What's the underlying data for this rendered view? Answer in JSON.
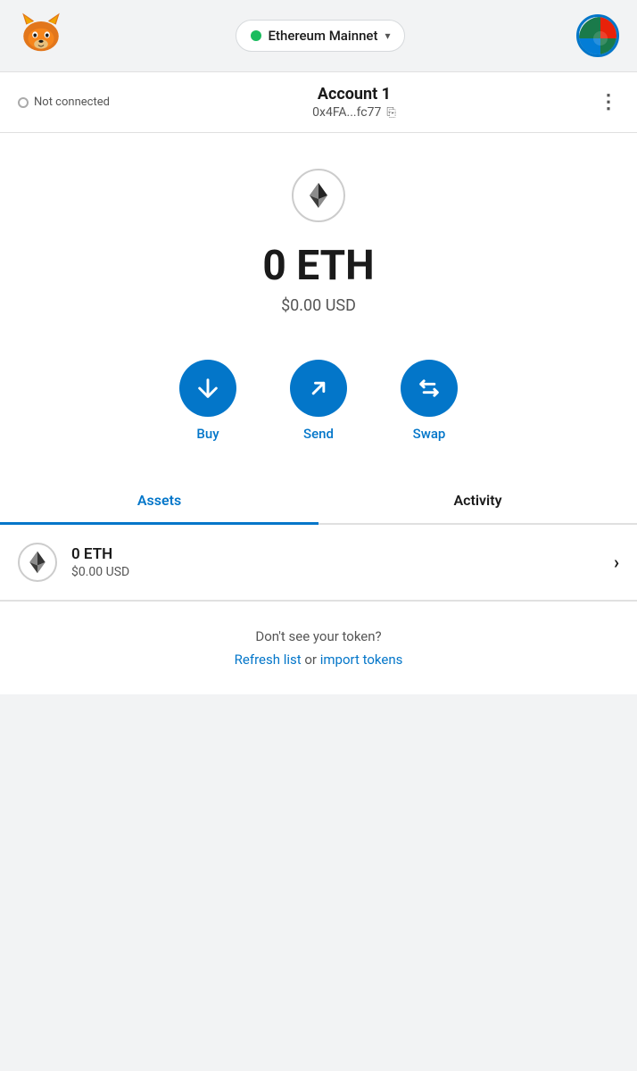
{
  "header": {
    "network": {
      "name": "Ethereum Mainnet",
      "status": "connected",
      "dot_color": "#1abc5e"
    },
    "chevron": "▾"
  },
  "account": {
    "title": "Account 1",
    "address": "0x4FA...fc77",
    "connection_status": "Not connected"
  },
  "balance": {
    "eth": "0 ETH",
    "usd": "$0.00 USD"
  },
  "actions": {
    "buy": "Buy",
    "send": "Send",
    "swap": "Swap"
  },
  "tabs": {
    "assets_label": "Assets",
    "activity_label": "Activity"
  },
  "asset": {
    "balance": "0 ETH",
    "usd": "$0.00 USD"
  },
  "footer": {
    "prompt": "Don't see your token?",
    "refresh": "Refresh list",
    "or": " or ",
    "import": "import tokens"
  }
}
